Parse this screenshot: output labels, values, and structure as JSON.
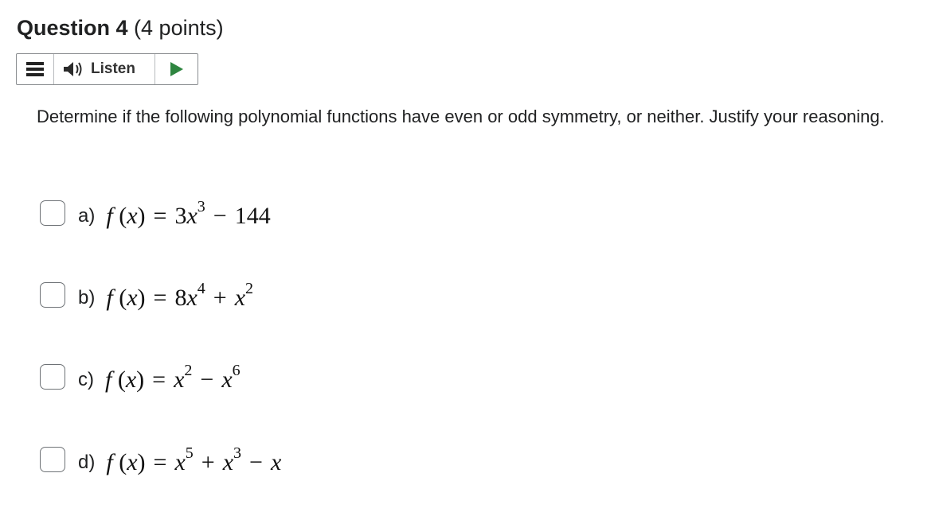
{
  "question": {
    "title": "Question 4",
    "points": "(4 points)"
  },
  "listen": {
    "menu_icon": "menu-icon",
    "speaker_icon": "speaker-icon",
    "label": "Listen",
    "play_icon": "play-icon",
    "play_color": "#2e8540"
  },
  "prompt": "Determine if the following polynomial functions have even or odd symmetry, or neither. Justify your reasoning.",
  "options": [
    {
      "letter": "a)",
      "lhs": "f",
      "arg": "(x)",
      "expression": "f (x) = 3x³ − 144",
      "checked": false
    },
    {
      "letter": "b)",
      "lhs": "f",
      "arg": "(x)",
      "expression": "f (x) = 8x⁴ + x²",
      "checked": false
    },
    {
      "letter": "c)",
      "lhs": "f",
      "arg": "(x)",
      "expression": "f (x) = x² − x⁶",
      "checked": false
    },
    {
      "letter": "d)",
      "lhs": "f",
      "arg": "(x)",
      "expression": "f (x) = x⁵ + x³ − x",
      "checked": false
    }
  ]
}
